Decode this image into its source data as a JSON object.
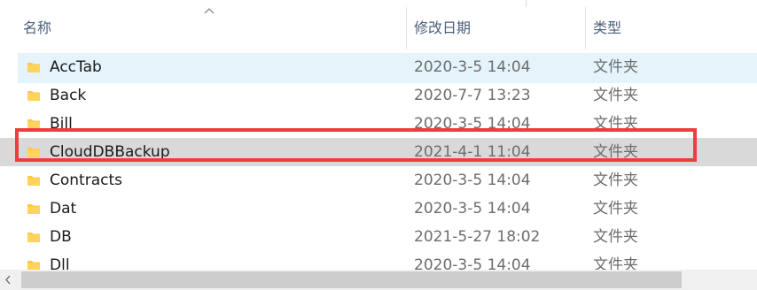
{
  "header": {
    "name_label": "名称",
    "date_label": "修改日期",
    "type_label": "类型"
  },
  "rows": [
    {
      "name": "AccTab",
      "date": "2020-3-5 14:04",
      "type": "文件夹",
      "state": "selected"
    },
    {
      "name": "Back",
      "date": "2020-7-7 13:23",
      "type": "文件夹",
      "state": ""
    },
    {
      "name": "Bill",
      "date": "2020-3-5 14:04",
      "type": "文件夹",
      "state": ""
    },
    {
      "name": "CloudDBBackup",
      "date": "2021-4-1 11:04",
      "type": "文件夹",
      "state": "hover"
    },
    {
      "name": "Contracts",
      "date": "2020-3-5 14:04",
      "type": "文件夹",
      "state": ""
    },
    {
      "name": "Dat",
      "date": "2020-3-5 14:04",
      "type": "文件夹",
      "state": ""
    },
    {
      "name": "DB",
      "date": "2021-5-27 18:02",
      "type": "文件夹",
      "state": ""
    },
    {
      "name": "Dll",
      "date": "2020-3-5 14:04",
      "type": "文件夹",
      "state": ""
    }
  ],
  "colors": {
    "selected_bg": "#e5f3fb",
    "hover_bg": "#d9d9d9",
    "highlight_box": "#f33a3e",
    "folder_yellow": "#ffc83d"
  },
  "icons": {
    "folder": "folder-icon",
    "sort": "sort-ascending-icon"
  }
}
